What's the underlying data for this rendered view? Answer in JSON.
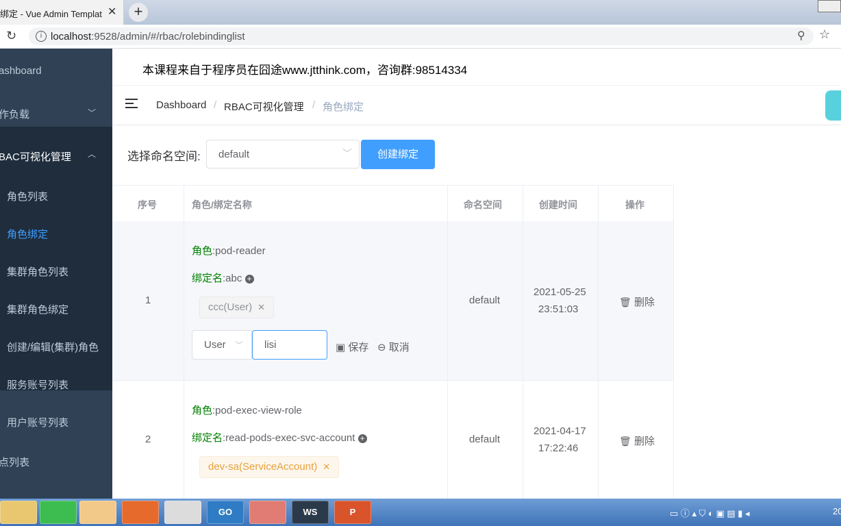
{
  "browser": {
    "tab_title": "绑定 - Vue Admin Templat",
    "url_host": "localhost",
    "url_rest": ":9528/admin/#/rbac/rolebindinglist"
  },
  "sidebar": {
    "dashboard": "ashboard",
    "workload": "作负载",
    "rbac": "BAC可视化管理",
    "sub": [
      "角色列表",
      "角色绑定",
      "集群角色列表",
      "集群角色绑定",
      "创建/编辑(集群)角色",
      "服务账号列表",
      "用户账号列表"
    ],
    "nodes": "点列表"
  },
  "notice": "本课程来自于程序员在囧途www.jtthink.com，咨询群:98514334",
  "breadcrumb": [
    "Dashboard",
    "RBAC可视化管理",
    "角色绑定"
  ],
  "toolbar": {
    "ns_label": "选择命名空间:",
    "ns_value": "default",
    "create_button": "创建绑定"
  },
  "table": {
    "headers": [
      "序号",
      "角色/绑定名称",
      "命名空间",
      "创建时间",
      "操作"
    ],
    "role_prefix": "角色",
    "binding_prefix": "绑定名",
    "rows": [
      {
        "index": "1",
        "role": ":pod-reader",
        "binding": ":abc",
        "subject_tag": "ccc(User)",
        "namespace": "default",
        "date": "2021-05-25",
        "time": "23:51:03",
        "delete": "删除",
        "edit": {
          "kind": "User",
          "name": "lisi",
          "save": "保存",
          "cancel": "取消"
        }
      },
      {
        "index": "2",
        "role": ":pod-exec-view-role",
        "binding": ":read-pods-exec-svc-account",
        "subject_tag": "dev-sa(ServiceAccount)",
        "namespace": "default",
        "date": "2021-04-17",
        "time": "17:22:46",
        "delete": "删除"
      }
    ]
  },
  "taskbar": {
    "apps": [
      "",
      "",
      "",
      "",
      "",
      "GO",
      "",
      "WS",
      "P"
    ],
    "clock": "20"
  }
}
